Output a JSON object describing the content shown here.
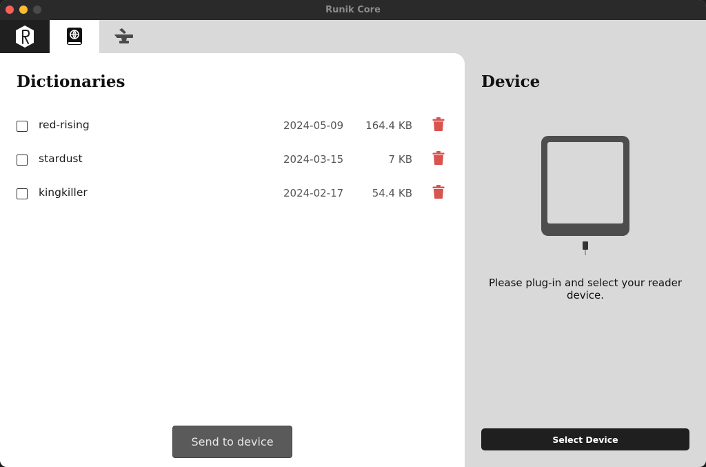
{
  "window": {
    "title": "Runik Core"
  },
  "tabs": [
    {
      "icon": "runik-logo-icon",
      "active": false
    },
    {
      "icon": "dictionary-book-icon",
      "active": true
    },
    {
      "icon": "anvil-icon",
      "active": false
    }
  ],
  "dictionaries": {
    "heading": "Dictionaries",
    "items": [
      {
        "name": "red-rising",
        "date": "2024-05-09",
        "size": "164.4 KB",
        "checked": false
      },
      {
        "name": "stardust",
        "date": "2024-03-15",
        "size": "7 KB",
        "checked": false
      },
      {
        "name": "kingkiller",
        "date": "2024-02-17",
        "size": "54.4 KB",
        "checked": false
      }
    ],
    "send_label": "Send to device"
  },
  "device": {
    "heading": "Device",
    "message": "Please plug-in and select your reader device.",
    "select_label": "Select Device"
  },
  "colors": {
    "accent_dark": "#1f1f1f",
    "trash": "#d9534f",
    "send_button": "#5a5a5a",
    "panel_bg": "#d9d9d9"
  }
}
